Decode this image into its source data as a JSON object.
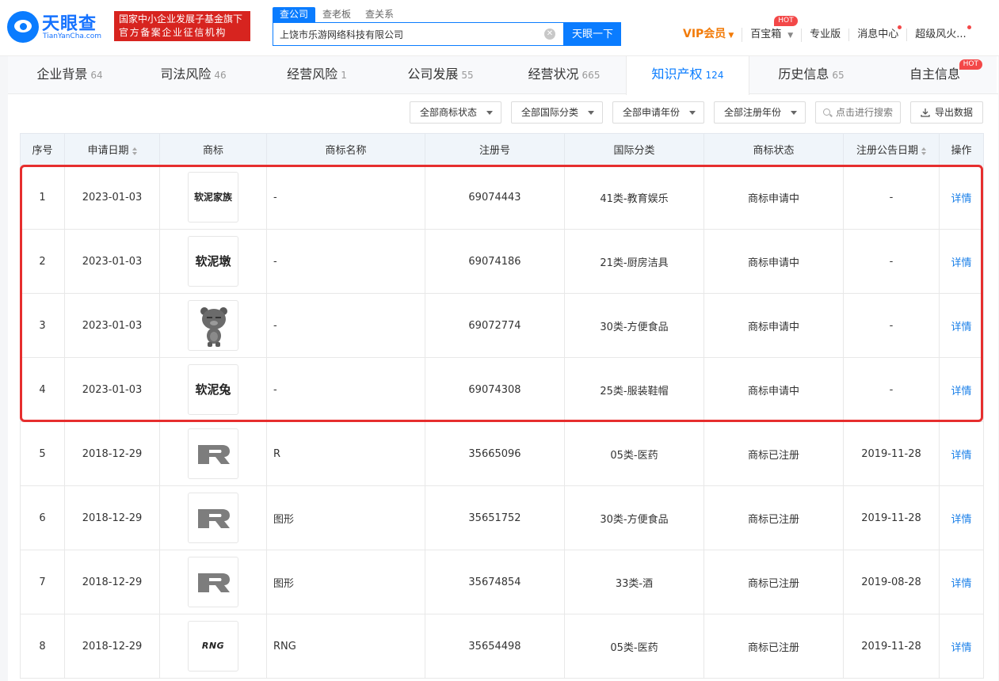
{
  "header": {
    "logo_cn": "天眼查",
    "logo_en": "TianYanCha.com",
    "badge_line1": "国家中小企业发展子基金旗下",
    "badge_line2": "官方备案企业征信机构",
    "search_tabs": [
      "查公司",
      "查老板",
      "查关系"
    ],
    "search_value": "上饶市乐游网络科技有限公司",
    "search_button": "天眼一下",
    "nav": {
      "vip": "VIP会员",
      "treasure": "百宝箱",
      "treasure_hot": "HOT",
      "pro": "专业版",
      "messages": "消息中心",
      "user": "超级风火..."
    }
  },
  "tabs": [
    {
      "label": "企业背景",
      "count": "64"
    },
    {
      "label": "司法风险",
      "count": "46"
    },
    {
      "label": "经营风险",
      "count": "1"
    },
    {
      "label": "公司发展",
      "count": "55"
    },
    {
      "label": "经营状况",
      "count": "665"
    },
    {
      "label": "知识产权",
      "count": "124"
    },
    {
      "label": "历史信息",
      "count": "65"
    },
    {
      "label": "自主信息",
      "count": "",
      "hot": "HOT"
    }
  ],
  "filters": {
    "status": "全部商标状态",
    "intl_class": "全部国际分类",
    "apply_year": "全部申请年份",
    "reg_year": "全部注册年份",
    "search_placeholder": "点击进行搜索",
    "export": "导出数据"
  },
  "table": {
    "headers": [
      "序号",
      "申请日期",
      "商标",
      "商标名称",
      "注册号",
      "国际分类",
      "商标状态",
      "注册公告日期",
      "操作"
    ],
    "rows": [
      {
        "no": "1",
        "date": "2023-01-03",
        "mark": "软泥家族",
        "name": "-",
        "reg": "69074443",
        "cls": "41类-教育娱乐",
        "status": "商标申请中",
        "pub": "-",
        "op": "详情"
      },
      {
        "no": "2",
        "date": "2023-01-03",
        "mark": "软泥墩",
        "name": "-",
        "reg": "69074186",
        "cls": "21类-厨房洁具",
        "status": "商标申请中",
        "pub": "-",
        "op": "详情"
      },
      {
        "no": "3",
        "date": "2023-01-03",
        "mark": "",
        "name": "-",
        "reg": "69072774",
        "cls": "30类-方便食品",
        "status": "商标申请中",
        "pub": "-",
        "op": "详情"
      },
      {
        "no": "4",
        "date": "2023-01-03",
        "mark": "软泥兔",
        "name": "-",
        "reg": "69074308",
        "cls": "25类-服装鞋帽",
        "status": "商标申请中",
        "pub": "-",
        "op": "详情"
      },
      {
        "no": "5",
        "date": "2018-12-29",
        "mark": "",
        "name": "R",
        "reg": "35665096",
        "cls": "05类-医药",
        "status": "商标已注册",
        "pub": "2019-11-28",
        "op": "详情"
      },
      {
        "no": "6",
        "date": "2018-12-29",
        "mark": "",
        "name": "图形",
        "reg": "35651752",
        "cls": "30类-方便食品",
        "status": "商标已注册",
        "pub": "2019-11-28",
        "op": "详情"
      },
      {
        "no": "7",
        "date": "2018-12-29",
        "mark": "",
        "name": "图形",
        "reg": "35674854",
        "cls": "33类-酒",
        "status": "商标已注册",
        "pub": "2019-08-28",
        "op": "详情"
      },
      {
        "no": "8",
        "date": "2018-12-29",
        "mark": "RNG",
        "name": "RNG",
        "reg": "35654498",
        "cls": "05类-医药",
        "status": "商标已注册",
        "pub": "2019-11-28",
        "op": "详情"
      }
    ]
  }
}
